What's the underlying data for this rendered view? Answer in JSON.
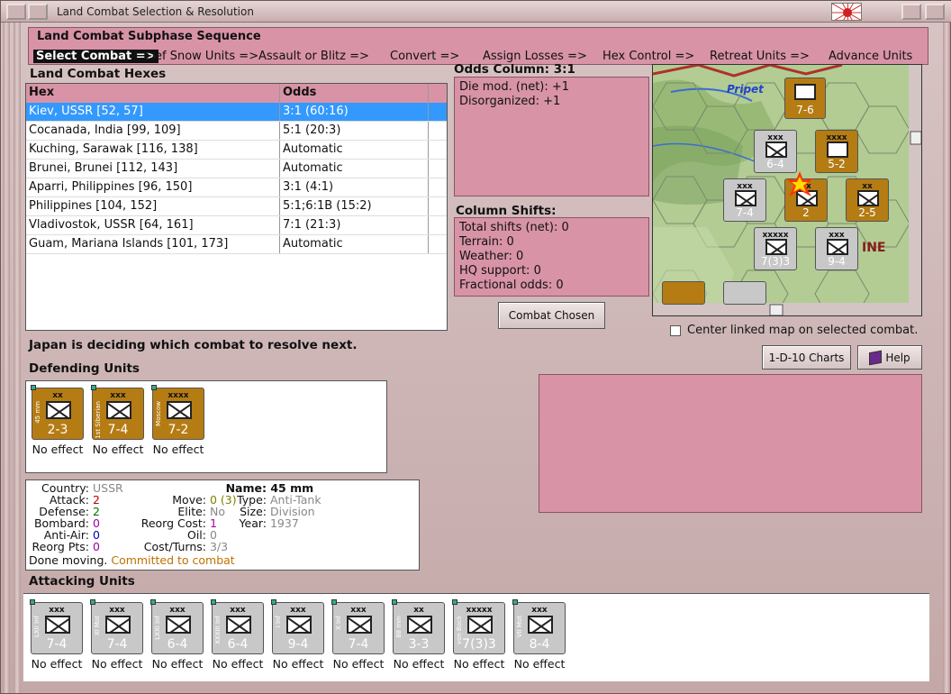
{
  "window": {
    "title": "Land Combat Selection & Resolution"
  },
  "sequence": {
    "title": "Land Combat Subphase Sequence",
    "steps": [
      "Select Combat =>",
      "Def Snow Units =>",
      "Assault or Blitz =>",
      "Convert =>",
      "Assign Losses =>",
      "Hex Control =>",
      "Retreat Units =>",
      "Advance Units"
    ]
  },
  "hexes": {
    "title": "Land Combat Hexes",
    "headers": [
      "Hex",
      "Odds"
    ],
    "rows": [
      {
        "hex": "Kiev, USSR [52, 57]",
        "odds": "3:1 (60:16)",
        "selected": true
      },
      {
        "hex": "Cocanada, India [99, 109]",
        "odds": "5:1 (20:3)"
      },
      {
        "hex": "Kuching, Sarawak [116, 138]",
        "odds": "Automatic"
      },
      {
        "hex": "Brunei, Brunei [112, 143]",
        "odds": "Automatic"
      },
      {
        "hex": "Aparri, Philippines [96, 150]",
        "odds": "3:1 (4:1)"
      },
      {
        "hex": "Philippines [104, 152]",
        "odds": "5:1;6:1B (15:2)"
      },
      {
        "hex": "Vladivostok, USSR [64, 161]",
        "odds": "7:1 (21:3)"
      },
      {
        "hex": "Guam, Mariana Islands [101, 173]",
        "odds": "Automatic"
      }
    ]
  },
  "odds": {
    "title": "Odds Column: 3:1",
    "lines": [
      "Die mod. (net): +1",
      "Disorganized: +1"
    ]
  },
  "shifts": {
    "title": "Column Shifts:",
    "lines": [
      "Total shifts (net): 0",
      "Terrain: 0",
      "Weather: 0",
      "HQ support: 0",
      "Fractional odds: 0"
    ]
  },
  "buttons": {
    "combat_chosen": "Combat Chosen",
    "charts": "1-D-10 Charts",
    "help": "Help"
  },
  "map": {
    "label": "Pripet",
    "ukraine": "INE",
    "center_label": "Center linked map on selected combat."
  },
  "status": "Japan is deciding which combat to resolve next.",
  "defending": {
    "title": "Defending Units",
    "units": [
      {
        "size": "xx",
        "side": "45 mm",
        "str": "2-3",
        "result": "No effect",
        "color": "br"
      },
      {
        "size": "xxx",
        "side": "1st Siberian",
        "str": "7-4",
        "result": "No effect",
        "color": "br"
      },
      {
        "size": "xxxx",
        "side": "Moscow",
        "str": "7-2",
        "result": "No effect",
        "color": "br"
      }
    ]
  },
  "info": {
    "country": "USSR",
    "attack": "2",
    "defense": "2",
    "bombard": "0",
    "anti_air": "0",
    "reorg_pts": "0",
    "done": "Done moving.",
    "committed": "Committed to combat",
    "move": "0 (3)",
    "elite": "No",
    "reorg_cost": "1",
    "oil": "0",
    "cost_turns": "3/3",
    "name": "45 mm",
    "type": "Anti-Tank",
    "size": "Division",
    "year": "1937",
    "labels": {
      "country": "Country:",
      "attack": "Attack:",
      "defense": "Defense:",
      "bombard": "Bombard:",
      "anti_air": "Anti-Air:",
      "reorg_pts": "Reorg Pts:",
      "move": "Move:",
      "elite": "Elite:",
      "reorg_cost": "Reorg Cost:",
      "oil": "Oil:",
      "cost_turns": "Cost/Turns:",
      "name": "Name:",
      "type": "Type:",
      "size": "Size:",
      "year": "Year:"
    }
  },
  "attacking": {
    "title": "Attacking Units",
    "units": [
      {
        "size": "xxx",
        "side": "LXII Inf",
        "str": "7-4",
        "result": "No effect"
      },
      {
        "size": "xxx",
        "side": "XI Mot",
        "str": "7-4",
        "result": "No effect"
      },
      {
        "size": "xxx",
        "side": "LXXI Inf",
        "str": "6-4",
        "result": "No effect"
      },
      {
        "size": "xxx",
        "side": "XXXIII Inf",
        "str": "6-4",
        "result": "No effect"
      },
      {
        "size": "xxx",
        "side": "I Inf",
        "str": "9-4",
        "result": "No effect"
      },
      {
        "size": "xxx",
        "side": "X Inf",
        "str": "7-4",
        "result": "No effect"
      },
      {
        "size": "xx",
        "side": "88 mm",
        "str": "3-3",
        "result": "No effect"
      },
      {
        "size": "xxxxx",
        "side": "von Bock",
        "str": "7(3)3",
        "result": "No effect"
      },
      {
        "size": "xxx",
        "side": "VII Mot",
        "str": "8-4",
        "result": "No effect"
      }
    ]
  },
  "colors": {
    "panel": "#d893a7",
    "select": "#3399ff",
    "counter_german": "#c8c8c8",
    "counter_soviet": "#b57c14",
    "committed": "#c07000",
    "attack": "#c00000",
    "defense": "#007000",
    "bombard": "#a000a0"
  }
}
